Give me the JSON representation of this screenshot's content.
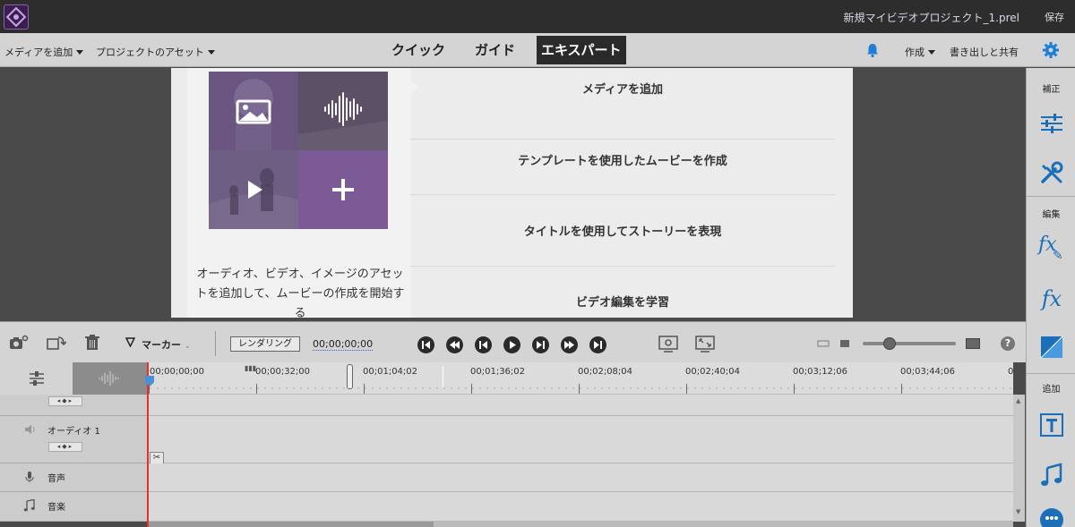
{
  "titlebar": {
    "project_title": "新規マイビデオプロジェクト_1.prel",
    "save": "保存"
  },
  "menubar": {
    "add_media": "メディアを追加",
    "project_assets": "プロジェクトのアセット",
    "tabs": [
      {
        "label": "クイック",
        "active": false
      },
      {
        "label": "ガイド",
        "active": false
      },
      {
        "label": "エキスパート",
        "active": true
      }
    ],
    "create": "作成",
    "export_share": "書き出しと共有"
  },
  "welcome": {
    "description": "オーディオ、ビデオ、イメージのアセットを追加して、ムービーの作成を開始する",
    "options": [
      "メディアを追加",
      "テンプレートを使用したムービーを作成",
      "タイトルを使用してストーリーを表現",
      "ビデオ編集を学習"
    ]
  },
  "timeline_toolbar": {
    "marker": "マーカー",
    "render": "レンダリング",
    "timecode": "00;00;00;00",
    "zoom_level": 0.25
  },
  "ruler": {
    "ticks": [
      "00;00;00;00",
      "00;00;32;00",
      "00;01;04;02",
      "00;01;36;02",
      "00;02;08;04",
      "00;02;40;04",
      "00;03;12;06",
      "00;03;44;06",
      "0"
    ]
  },
  "tracks": [
    {
      "name": "",
      "kind": "video-keyframes"
    },
    {
      "name": "オーディオ 1",
      "kind": "audio"
    },
    {
      "name": "音声",
      "kind": "voice"
    },
    {
      "name": "音楽",
      "kind": "music"
    }
  ],
  "right_panel": {
    "correct": "補正",
    "edit": "編集",
    "add": "追加",
    "fx_label": "fx"
  },
  "colors": {
    "accent_purple": "#7b5a96",
    "bell_blue": "#1e7fd8",
    "playhead_red": "#d33333",
    "icon_blue": "#1a6fb8"
  }
}
